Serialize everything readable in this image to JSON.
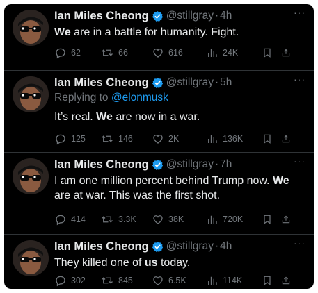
{
  "tweets": [
    {
      "name": "Ian Miles Cheong",
      "handle": "@stillgray",
      "dot": "·",
      "time": "4h",
      "reply_prefix": "",
      "reply_mention": "",
      "text_parts": [
        {
          "t": "We",
          "b": true
        },
        {
          "t": " are in a battle for humanity. Fight.",
          "b": false
        }
      ],
      "replies": "62",
      "reposts": "66",
      "likes": "616",
      "views": "24K"
    },
    {
      "name": "Ian Miles Cheong",
      "handle": "@stillgray",
      "dot": "·",
      "time": "5h",
      "reply_prefix": "Replying to ",
      "reply_mention": "@elonmusk",
      "text_parts": [
        {
          "t": "It’s real. ",
          "b": false
        },
        {
          "t": "We",
          "b": true
        },
        {
          "t": " are now in a war.",
          "b": false
        }
      ],
      "replies": "125",
      "reposts": "146",
      "likes": "2K",
      "views": "136K"
    },
    {
      "name": "Ian Miles Cheong",
      "handle": "@stillgray",
      "dot": "·",
      "time": "7h",
      "reply_prefix": "",
      "reply_mention": "",
      "text_parts": [
        {
          "t": "I am one million percent behind Trump now. ",
          "b": false
        },
        {
          "t": "We",
          "b": true
        },
        {
          "t": " are at war. This was the first shot.",
          "b": false
        }
      ],
      "replies": "414",
      "reposts": "3.3K",
      "likes": "38K",
      "views": "720K"
    },
    {
      "name": "Ian Miles Cheong",
      "handle": "@stillgray",
      "dot": "·",
      "time": "4h",
      "reply_prefix": "",
      "reply_mention": "",
      "text_parts": [
        {
          "t": "They killed one of ",
          "b": false
        },
        {
          "t": "us",
          "b": true
        },
        {
          "t": " today.",
          "b": false
        }
      ],
      "replies": "302",
      "reposts": "845",
      "likes": "6.5K",
      "views": "114K"
    }
  ],
  "more_label": "···",
  "colors": {
    "background": "#000000",
    "primary_text": "#e7e9ea",
    "secondary_text": "#71767b",
    "link": "#1d9bf0",
    "verified": "#1d9bf0",
    "divider": "#2f3336"
  },
  "icons": [
    "reply-icon",
    "repost-icon",
    "like-icon",
    "views-icon",
    "bookmark-icon",
    "share-icon",
    "verified-badge-icon",
    "more-icon"
  ]
}
